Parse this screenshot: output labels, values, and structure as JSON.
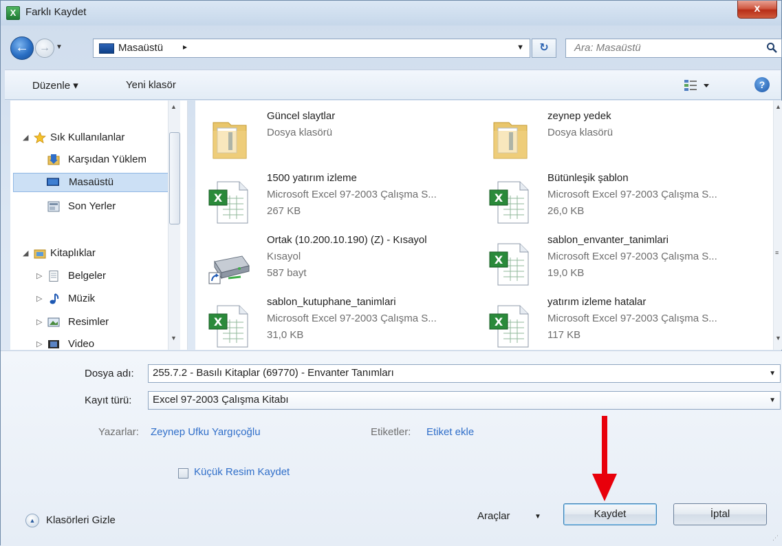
{
  "window": {
    "title": "Farklı Kaydet",
    "app_icon": "excel-icon",
    "close_label": "x"
  },
  "address": {
    "location": "Masaüstü",
    "separator": "▸",
    "search_placeholder": "Ara: Masaüstü"
  },
  "toolbar": {
    "organize_label": "Düzenle ▾",
    "new_folder_label": "Yeni klasör"
  },
  "nav": {
    "items": [
      {
        "label": "Sık Kullanılanlar",
        "icon": "star-icon",
        "expander": "◢"
      },
      {
        "label": "Karşıdan Yüklem",
        "icon": "downloads-folder-icon"
      },
      {
        "label": "Masaüstü",
        "icon": "desktop-icon",
        "selected": true
      },
      {
        "label": "Son Yerler",
        "icon": "recent-places-icon"
      },
      {
        "label": "Kitaplıklar",
        "icon": "libraries-icon",
        "expander": "◢"
      },
      {
        "label": "Belgeler",
        "icon": "documents-icon",
        "expander": "▷"
      },
      {
        "label": "Müzik",
        "icon": "music-icon",
        "expander": "▷"
      },
      {
        "label": "Resimler",
        "icon": "pictures-icon",
        "expander": "▷"
      },
      {
        "label": "Video",
        "icon": "video-icon",
        "expander": "▷"
      }
    ]
  },
  "files": [
    {
      "name": "Güncel slaytlar",
      "type": "Dosya klasörü",
      "size": "",
      "icon": "folder-icon"
    },
    {
      "name": "zeynep yedek",
      "type": "Dosya klasörü",
      "size": "",
      "icon": "folder-icon"
    },
    {
      "name": "1500 yatırım izleme",
      "type": "Microsoft Excel 97-2003 Çalışma S...",
      "size": "267 KB",
      "icon": "excel-file-icon"
    },
    {
      "name": "Bütünleşik şablon",
      "type": "Microsoft Excel 97-2003 Çalışma S...",
      "size": "26,0 KB",
      "icon": "excel-file-icon"
    },
    {
      "name": "Ortak (10.200.10.190) (Z) - Kısayol",
      "type": "Kısayol",
      "size": "587 bayt",
      "icon": "network-drive-shortcut-icon"
    },
    {
      "name": "sablon_envanter_tanimlari",
      "type": "Microsoft Excel 97-2003 Çalışma S...",
      "size": "19,0 KB",
      "icon": "excel-file-icon"
    },
    {
      "name": "sablon_kutuphane_tanimlari",
      "type": "Microsoft Excel 97-2003 Çalışma S...",
      "size": "31,0 KB",
      "icon": "excel-file-icon"
    },
    {
      "name": "yatırım izleme hatalar",
      "type": "Microsoft Excel 97-2003 Çalışma S...",
      "size": "117 KB",
      "icon": "excel-file-icon"
    }
  ],
  "form": {
    "filename_label": "Dosya adı:",
    "filename_value": "255.7.2 - Basılı Kitaplar (69770) - Envanter Tanımları",
    "filetype_label": "Kayıt türü:",
    "filetype_value": "Excel 97-2003 Çalışma Kitabı",
    "authors_label": "Yazarlar:",
    "authors_value": "Zeynep Ufku Yargıçoğlu",
    "tags_label": "Etiketler:",
    "tags_value": "Etiket ekle",
    "thumbnail_label": "Küçük Resim Kaydet",
    "thumbnail_checked": false
  },
  "footer": {
    "hide_folders_label": "Klasörleri Gizle",
    "tools_label": "Araçlar",
    "save_label": "Kaydet",
    "cancel_label": "İptal"
  },
  "colors": {
    "accent": "#2f6ec9",
    "annotation_arrow": "#e8000b",
    "selection": "#cce0f5"
  }
}
